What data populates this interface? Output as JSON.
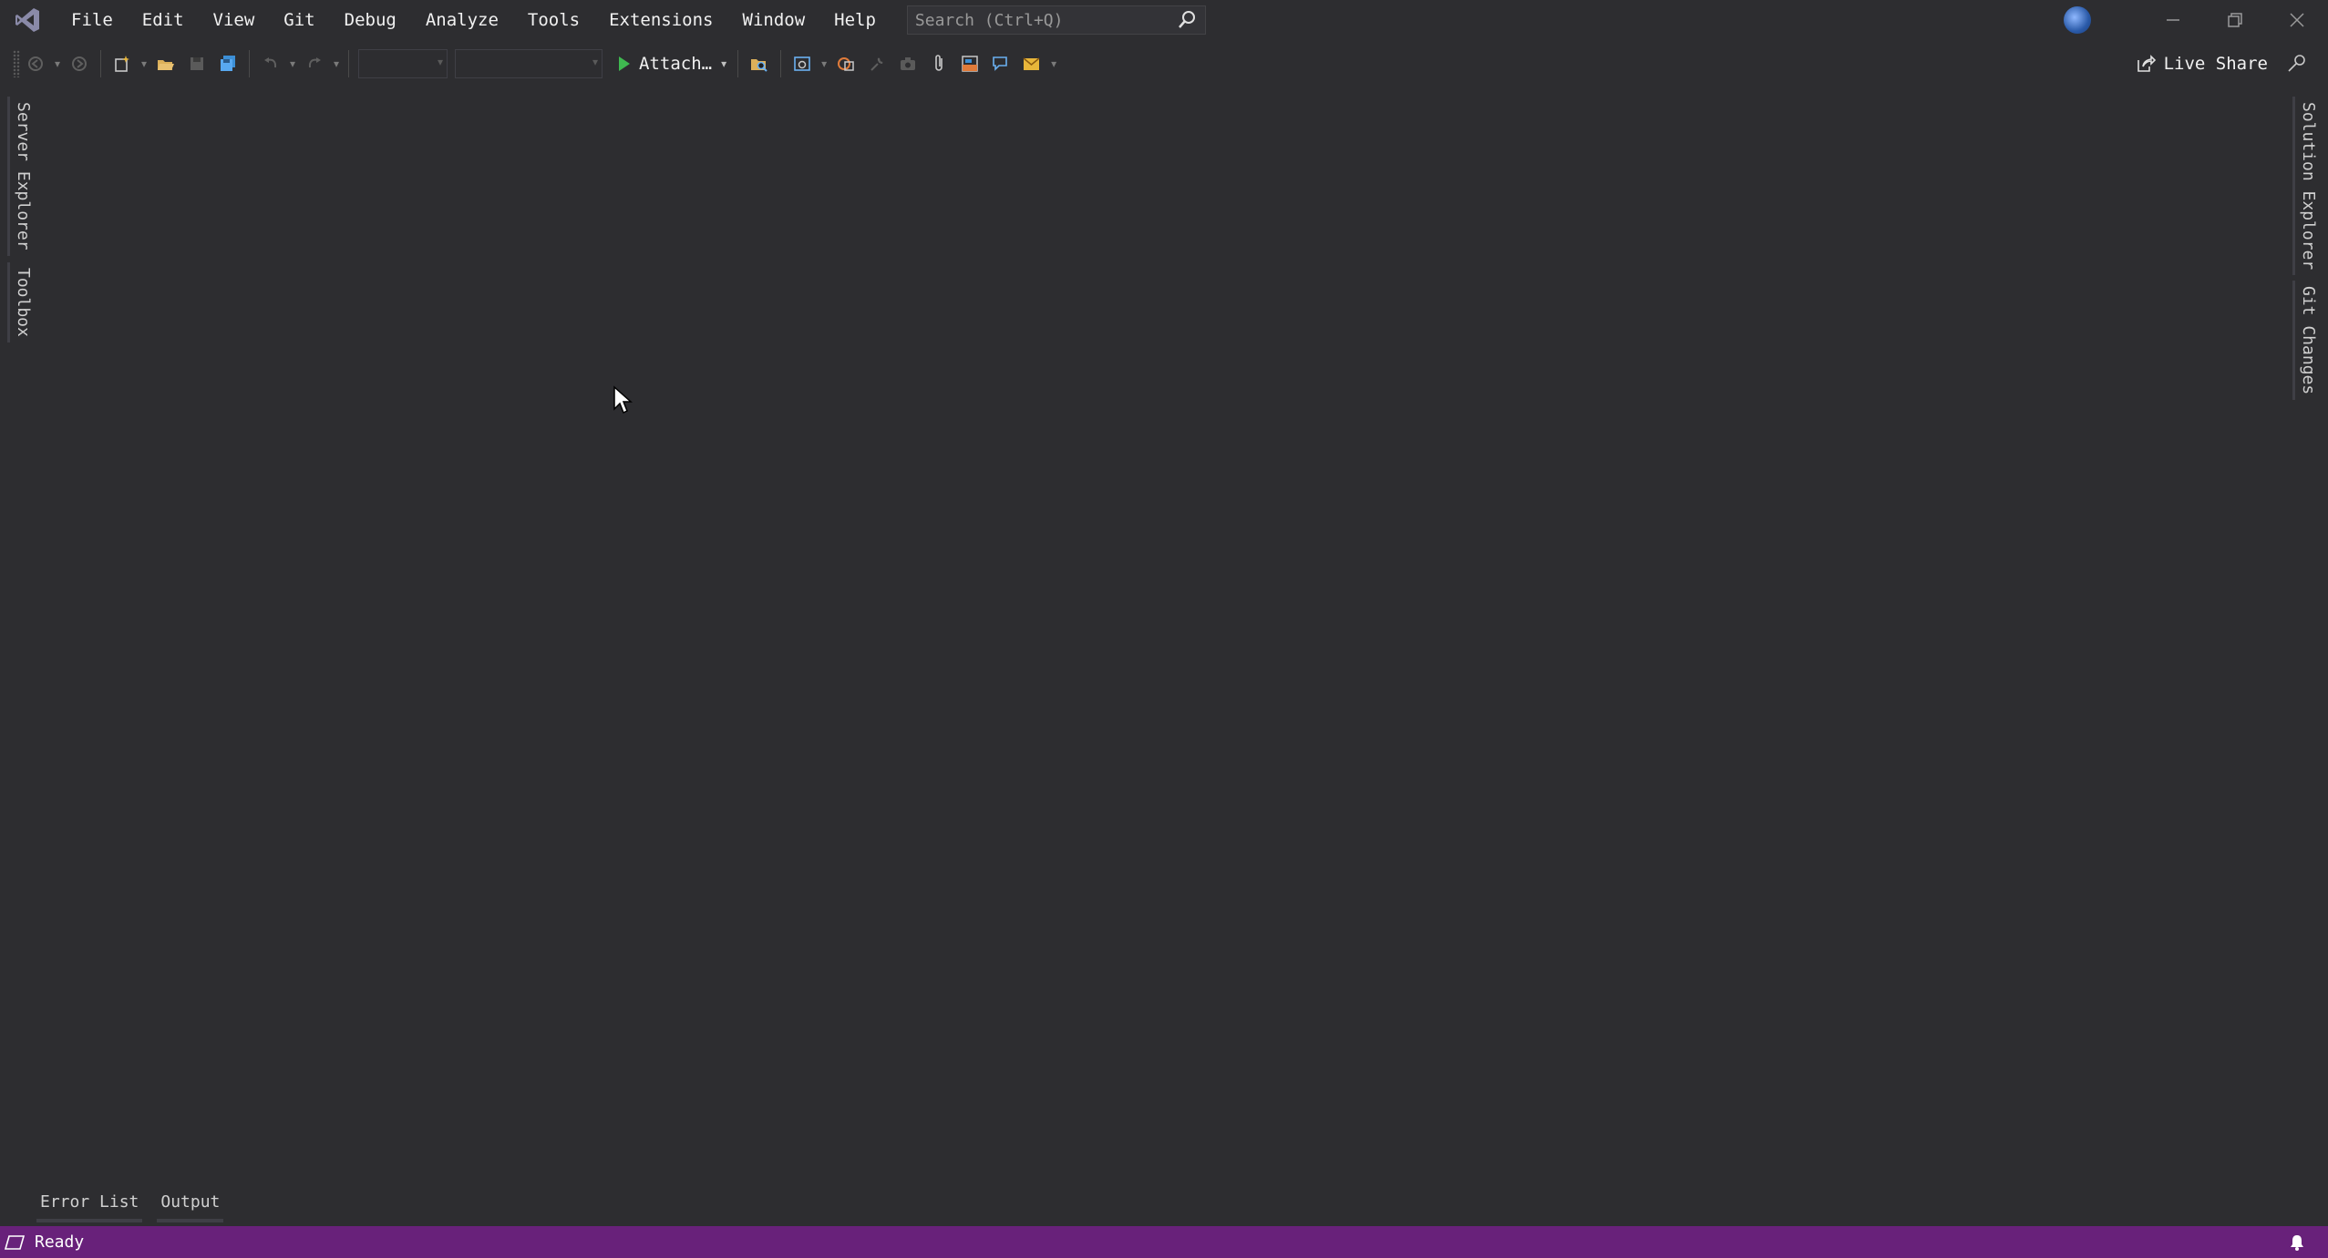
{
  "menu": {
    "items": [
      "File",
      "Edit",
      "View",
      "Git",
      "Debug",
      "Analyze",
      "Tools",
      "Extensions",
      "Window",
      "Help"
    ]
  },
  "search": {
    "placeholder": "Search (Ctrl+Q)"
  },
  "toolbar": {
    "attach_label": "Attach…",
    "live_share_label": "Live Share"
  },
  "left_rail": {
    "tabs": [
      "Server Explorer",
      "Toolbox"
    ]
  },
  "right_rail": {
    "tabs": [
      "Solution Explorer",
      "Git Changes"
    ]
  },
  "bottom_tabs": [
    "Error List",
    "Output"
  ],
  "status": {
    "text": "Ready"
  },
  "colors": {
    "background": "#2d2d30",
    "statusbar": "#68217a",
    "accent_logo": "#8a8aa8"
  },
  "icons": {
    "logo": "visual-studio-logo-icon",
    "search": "search-icon",
    "account": "globe-icon",
    "minimize": "minimize-icon",
    "restore": "restore-icon",
    "close": "close-icon",
    "live_share": "share-icon",
    "pin": "pin-icon",
    "bell": "bell-icon"
  }
}
